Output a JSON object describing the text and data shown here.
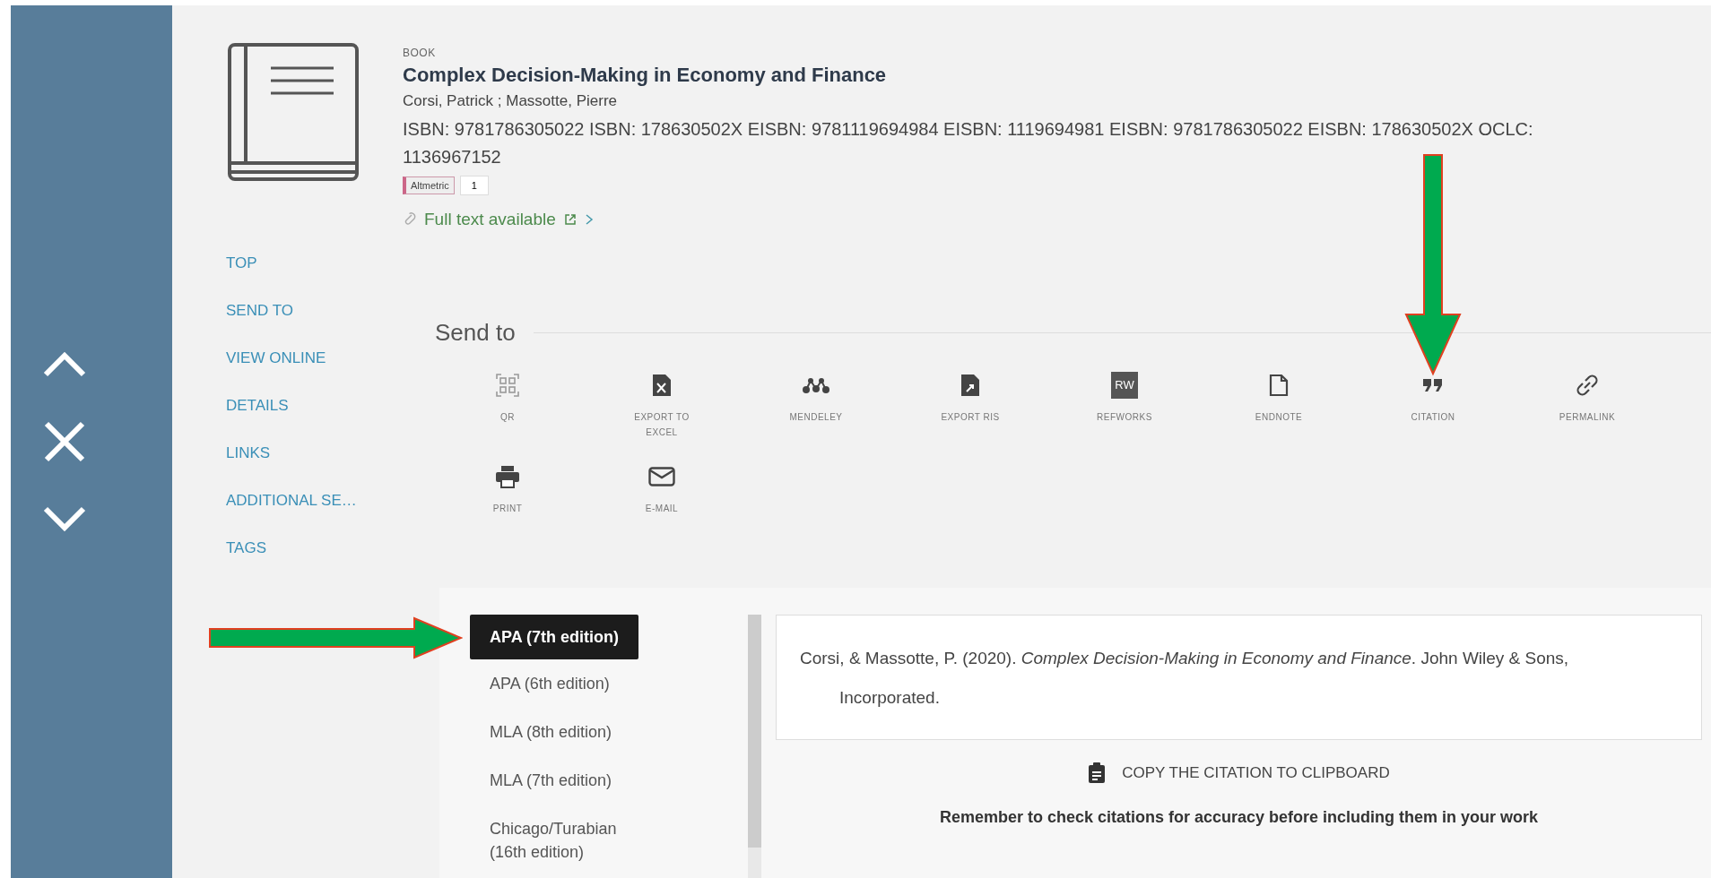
{
  "overlay_controls": [
    {
      "kind": "previous"
    },
    {
      "kind": "close"
    },
    {
      "kind": "next"
    }
  ],
  "record": {
    "type": "BOOK",
    "title": "Complex Decision-Making in Economy and Finance",
    "authors": "Corsi, Patrick ; Massotte, Pierre",
    "identifiers": "ISBN: 9781786305022 ISBN: 178630502X EISBN: 9781119694984 EISBN: 1119694981 EISBN: 9781786305022 EISBN: 178630502X OCLC: 1136967152",
    "altmetric": {
      "label": "Altmetric",
      "score": "1"
    },
    "full_text": "Full text available"
  },
  "section_nav": [
    {
      "label": "TOP"
    },
    {
      "label": "SEND TO"
    },
    {
      "label": "VIEW ONLINE"
    },
    {
      "label": "DETAILS"
    },
    {
      "label": "LINKS"
    },
    {
      "label": "ADDITIONAL SE…"
    },
    {
      "label": "TAGS"
    }
  ],
  "send_to": {
    "heading": "Send to",
    "actions": [
      {
        "kind": "qr",
        "label": "QR",
        "highlighted": false
      },
      {
        "kind": "excel",
        "label": "EXPORT TO EXCEL",
        "highlighted": false
      },
      {
        "kind": "mendeley",
        "label": "MENDELEY",
        "highlighted": false
      },
      {
        "kind": "ris",
        "label": "EXPORT RIS",
        "highlighted": false
      },
      {
        "kind": "refworks",
        "icon_text": "RW",
        "label": "REFWORKS",
        "highlighted": false
      },
      {
        "kind": "endnote",
        "label": "ENDNOTE",
        "highlighted": false
      },
      {
        "kind": "citation",
        "label": "CITATION",
        "highlighted": true
      },
      {
        "kind": "permalink",
        "label": "PERMALINK",
        "highlighted": false
      },
      {
        "kind": "print",
        "label": "PRINT",
        "highlighted": false
      },
      {
        "kind": "email",
        "label": "E-MAIL",
        "highlighted": false
      }
    ]
  },
  "citation": {
    "styles": [
      {
        "label": "APA (7th edition)",
        "selected": true,
        "highlighted": true
      },
      {
        "label": "APA (6th edition)",
        "selected": false,
        "highlighted": false
      },
      {
        "label": "MLA (8th edition)",
        "selected": false,
        "highlighted": false
      },
      {
        "label": "MLA (7th edition)",
        "selected": false,
        "highlighted": false
      },
      {
        "label": "Chicago/Turabian (16th edition)",
        "selected": false,
        "highlighted": false
      }
    ],
    "text": "Corsi, & Massotte, P. (2020). *Complex Decision-Making in Economy and Finance*. John Wiley & Sons, Incorporated.",
    "copy": "COPY THE CITATION TO CLIPBOARD",
    "note": "Remember to check citations for accuracy before including them in your work"
  }
}
